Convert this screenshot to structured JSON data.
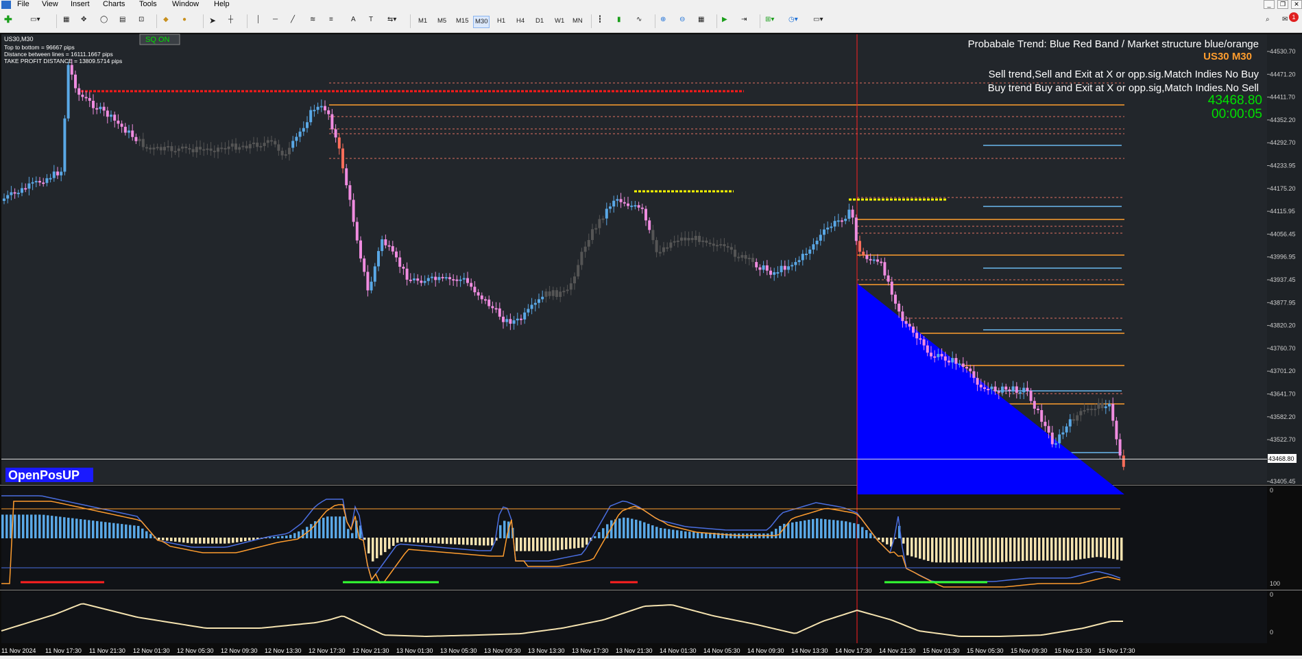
{
  "menu": {
    "items": [
      "File",
      "View",
      "Insert",
      "Charts",
      "Tools",
      "Window",
      "Help"
    ]
  },
  "toolbar": {
    "timeframes": [
      "M1",
      "M5",
      "M15",
      "M30",
      "H1",
      "H4",
      "D1",
      "W1",
      "MN"
    ],
    "active_timeframe": "M30",
    "notification_count": "1"
  },
  "chart": {
    "symbol_label": "US30,M30",
    "info_lines": [
      "Top to bottom = 96667 pips",
      "Distance between lines = 16111.1667 pips",
      "TAKE PROFIT DISTANCE = 13809.5714 pips"
    ],
    "sq_button": "SQ ON",
    "trend_title": "Probabale Trend: Blue Red Band  / Market structure blue/orange",
    "symbol_tf": "US30   M30",
    "sell_note": "Sell trend,Sell and Exit at X or opp.sig.Match Indies No Buy",
    "buy_note": "Buy trend Buy and Exit at X or opp.sig,Match Indies.No Sell",
    "current_price": "43468.80",
    "countdown": "00:00:05",
    "openpos_label": "OpenPosUP",
    "price_axis": [
      "44530.70",
      "44471.20",
      "44411.70",
      "44352.20",
      "44292.70",
      "44233.95",
      "44175.20",
      "44115.95",
      "44056.45",
      "43996.95",
      "43937.45",
      "43877.95",
      "43820.20",
      "43760.70",
      "43701.20",
      "43641.70",
      "43582.20",
      "43522.70",
      "43468.80",
      "43405.45"
    ],
    "indicator1_axis": [
      "0",
      "100"
    ],
    "indicator2_axis": [
      "0",
      "0"
    ],
    "time_axis": [
      "11 Nov 2024",
      "11 Nov 17:30",
      "11 Nov 21:30",
      "12 Nov 01:30",
      "12 Nov 05:30",
      "12 Nov 09:30",
      "12 Nov 13:30",
      "12 Nov 17:30",
      "12 Nov 21:30",
      "13 Nov 01:30",
      "13 Nov 05:30",
      "13 Nov 09:30",
      "13 Nov 13:30",
      "13 Nov 17:30",
      "13 Nov 21:30",
      "14 Nov 01:30",
      "14 Nov 05:30",
      "14 Nov 09:30",
      "14 Nov 13:30",
      "14 Nov 17:30",
      "14 Nov 21:30",
      "15 Nov 01:30",
      "15 Nov 05:30",
      "15 Nov 09:30",
      "15 Nov 13:30",
      "15 Nov 17:30"
    ]
  },
  "colors": {
    "background": "#22262b",
    "bull": "#5aa8e6",
    "bear": "#f08ce0",
    "neutral": "#555555",
    "blue_zone": "#0000ff",
    "orange": "#ff9d2e",
    "red": "#ff2020",
    "yellow": "#ffff00",
    "green_text": "#00e000",
    "accent_orange": "#ff9d2e"
  }
}
